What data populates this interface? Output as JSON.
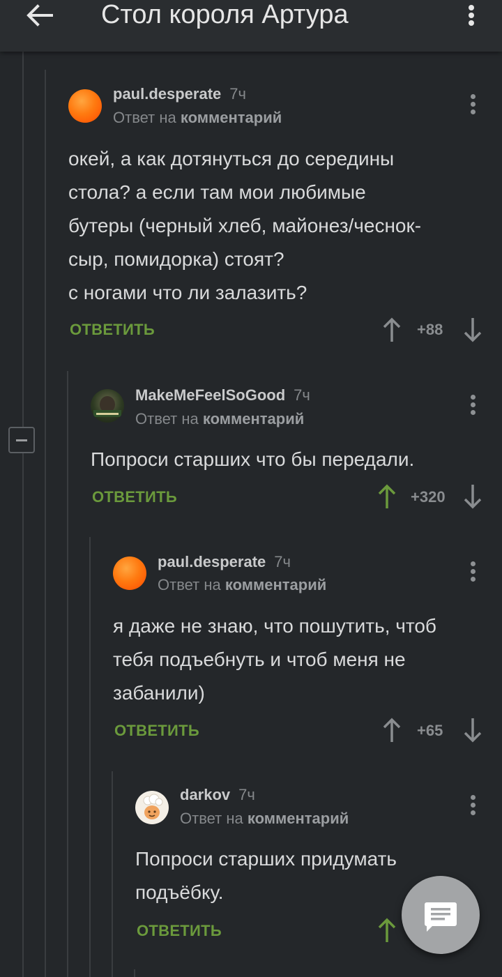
{
  "header": {
    "title": "Стол короля Артура",
    "back_icon": "arrow-left-icon",
    "menu_icon": "more-vertical-icon"
  },
  "comments": [
    {
      "username": "paul.desperate",
      "time": "7ч",
      "reply_prefix": "Ответ на",
      "reply_link": "комментарий",
      "lines": [
        "окей, а как дотянуться до середины",
        "стола? а если там мои любимые",
        "бутеры (черный хлеб, майонез/чеснок-",
        "сыр, помидорка) стоят?",
        "с ногами что ли залазить?"
      ],
      "reply_label": "ОТВЕТИТЬ",
      "score": "+88",
      "upvoted": false
    },
    {
      "username": "MakeMeFeelSoGood",
      "time": "7ч",
      "reply_prefix": "Ответ на",
      "reply_link": "комментарий",
      "lines": [
        "Попроси старших что бы передали."
      ],
      "reply_label": "ОТВЕТИТЬ",
      "score": "+320",
      "upvoted": true
    },
    {
      "username": "paul.desperate",
      "time": "7ч",
      "reply_prefix": "Ответ на",
      "reply_link": "комментарий",
      "lines": [
        "я даже не знаю, что пошутить, чтоб",
        "тебя подъебнуть и чтоб меня не",
        "забанили)"
      ],
      "reply_label": "ОТВЕТИТЬ",
      "score": "+65",
      "upvoted": false
    },
    {
      "username": "darkov",
      "time": "7ч",
      "reply_prefix": "Ответ на",
      "reply_link": "комментарий",
      "lines": [
        "Попроси старших придумать",
        "подъёбку."
      ],
      "reply_label": "ОТВЕТИТЬ",
      "upvoted": true
    }
  ],
  "colors": {
    "background": "#24272a",
    "accent_green": "#6b9a3c",
    "upvote_active": "#6b9a3c"
  },
  "fab": {
    "icon": "comment-icon"
  }
}
